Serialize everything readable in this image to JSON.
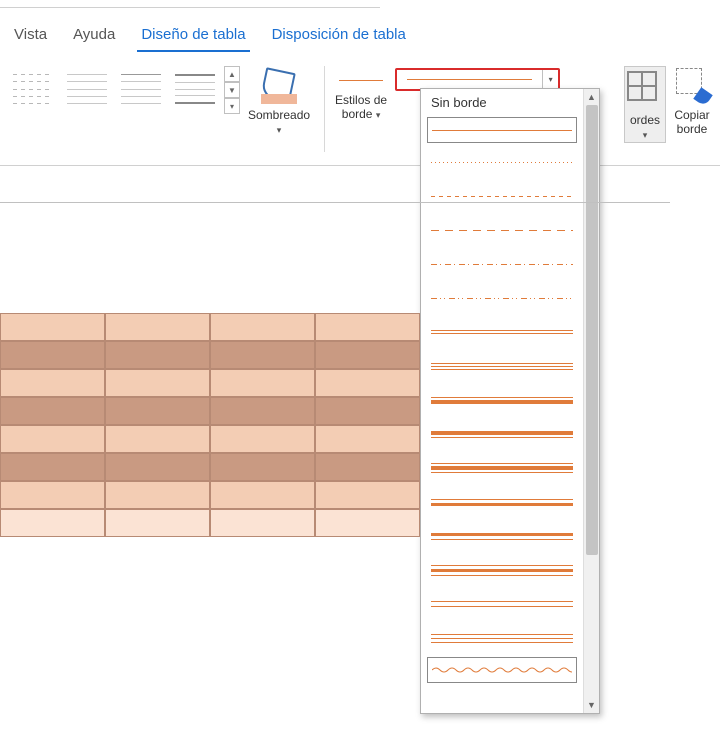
{
  "tabs": {
    "vista": "Vista",
    "ayuda": "Ayuda",
    "diseno_tabla": "Diseño de tabla",
    "disposicion_tabla": "Disposición de tabla"
  },
  "ribbon": {
    "sombreado": "Sombreado",
    "estilos_de_borde": "Estilos de\nborde",
    "bordes": "ordes",
    "copiar_borde": "Copiar\nborde"
  },
  "dropdown": {
    "sin_borde": "Sin borde"
  },
  "colors": {
    "accent_orange": "#e07b3a",
    "highlight_red": "#d92b2b",
    "tab_blue": "#1a6fd1"
  }
}
